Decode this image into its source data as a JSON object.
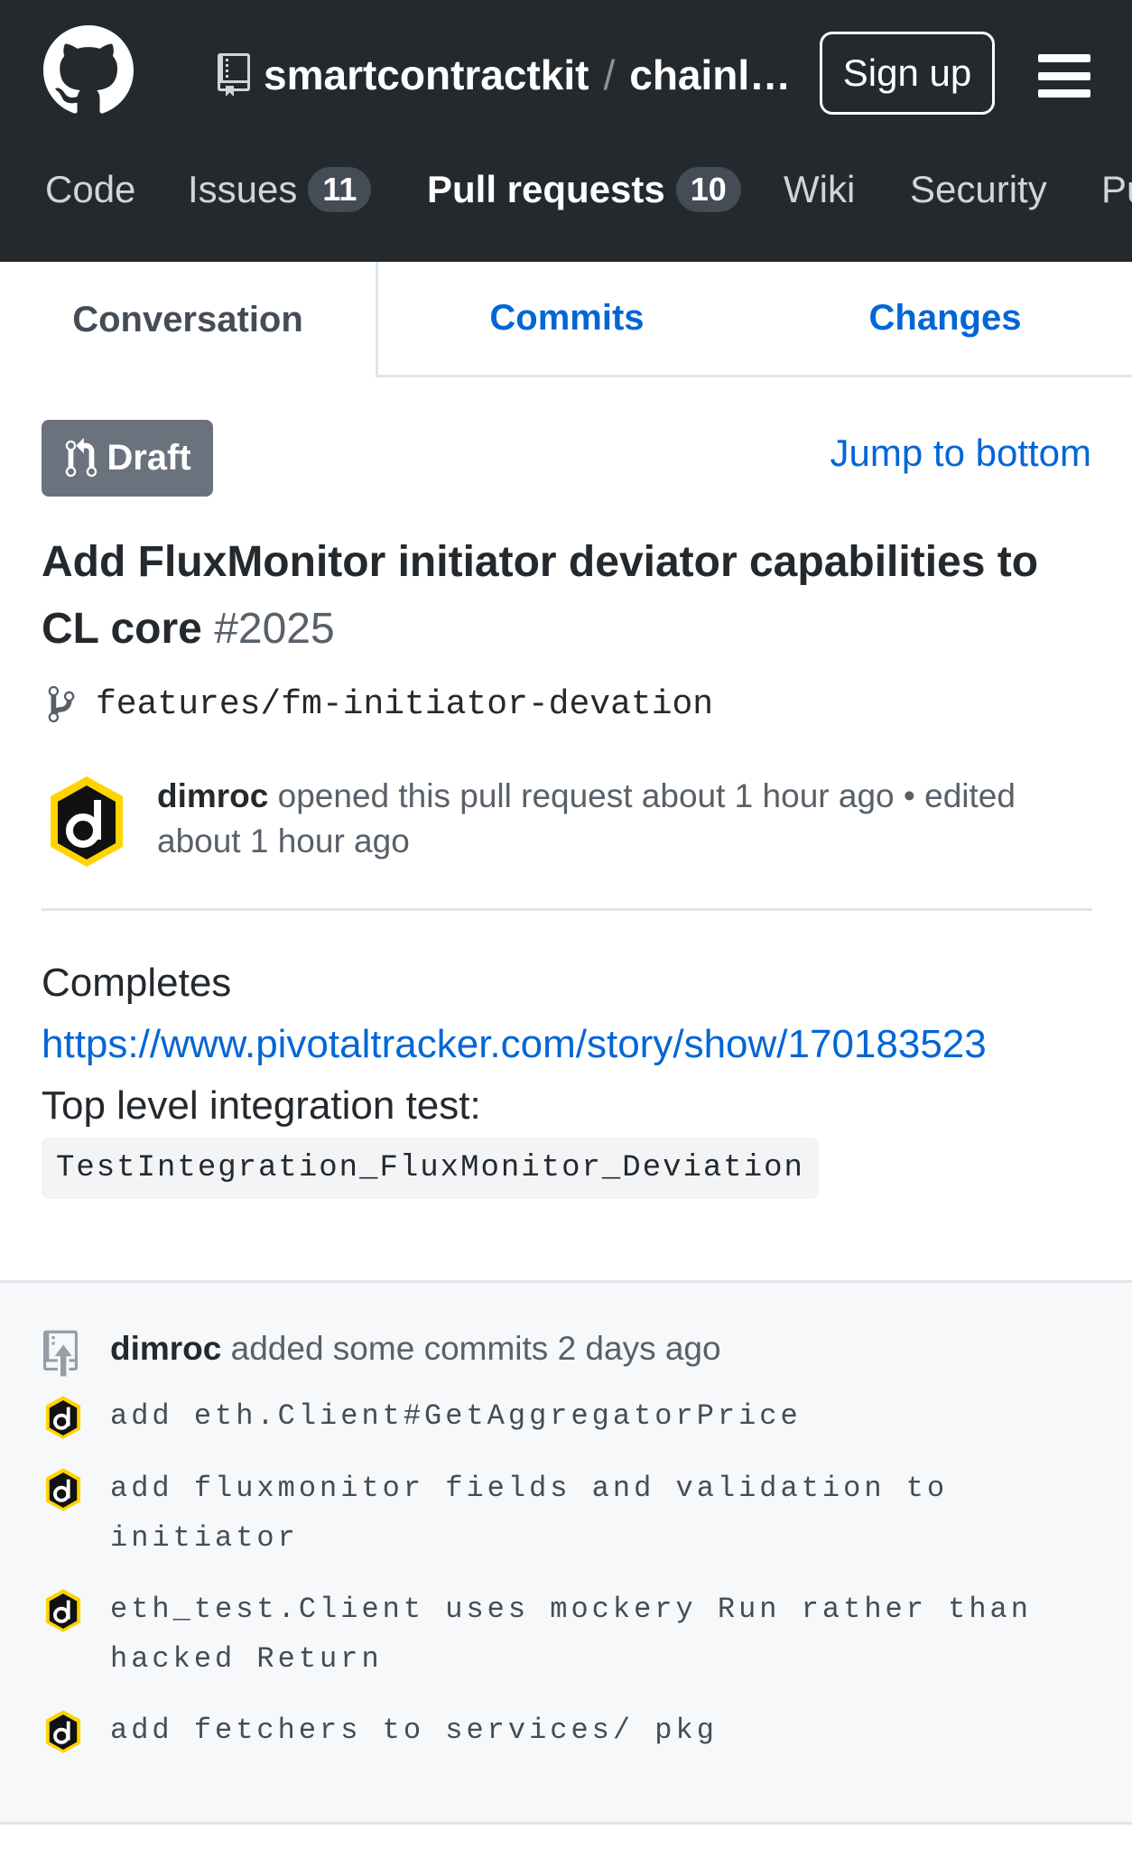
{
  "header": {
    "repo_owner": "smartcontractkit",
    "repo_separator": "/",
    "repo_name": "chainli...",
    "signup_label": "Sign up",
    "colors": {
      "background": "#24292e",
      "counter": "#444d56"
    }
  },
  "nav": {
    "items": [
      {
        "label": "Code"
      },
      {
        "label": "Issues",
        "count": "11"
      },
      {
        "label": "Pull requests",
        "count": "10"
      },
      {
        "label": "Wiki"
      },
      {
        "label": "Security"
      },
      {
        "label": "Pu"
      }
    ]
  },
  "tabs": [
    {
      "label": "Conversation"
    },
    {
      "label": "Commits"
    },
    {
      "label": "Changes"
    }
  ],
  "pr": {
    "state": "Draft",
    "jump_label": "Jump to bottom",
    "title": "Add FluxMonitor initiator deviator capabilities to CL core",
    "number": "#2025",
    "branch": "features/fm-initiator-devation",
    "author": "dimroc",
    "opened_text": "opened this pull request about 1 hour ago • edited about 1 hour ago",
    "body": {
      "line1": "Completes",
      "link": "https://www.pivotaltracker.com/story/show/170183523",
      "line3": "Top level integration test:",
      "code": "TestIntegration_FluxMonitor_Deviation"
    }
  },
  "commits": {
    "author": "dimroc",
    "header_text": "added some commits 2 days ago",
    "items": [
      {
        "message": "add eth.Client#GetAggregatorPrice"
      },
      {
        "message": "add fluxmonitor fields and validation to initiator"
      },
      {
        "message": "eth_test.Client uses mockery Run rather than hacked Return"
      },
      {
        "message": "add fetchers to services/ pkg"
      }
    ]
  },
  "icons": [
    "github-logo-icon",
    "repo-icon",
    "menu-icon",
    "git-pull-request-icon",
    "git-branch-icon",
    "avatar-dimroc",
    "repo-push-icon"
  ],
  "colors": {
    "link": "#0366d6",
    "draft": "#6a737d",
    "text": "#24292e",
    "muted": "#586069"
  }
}
